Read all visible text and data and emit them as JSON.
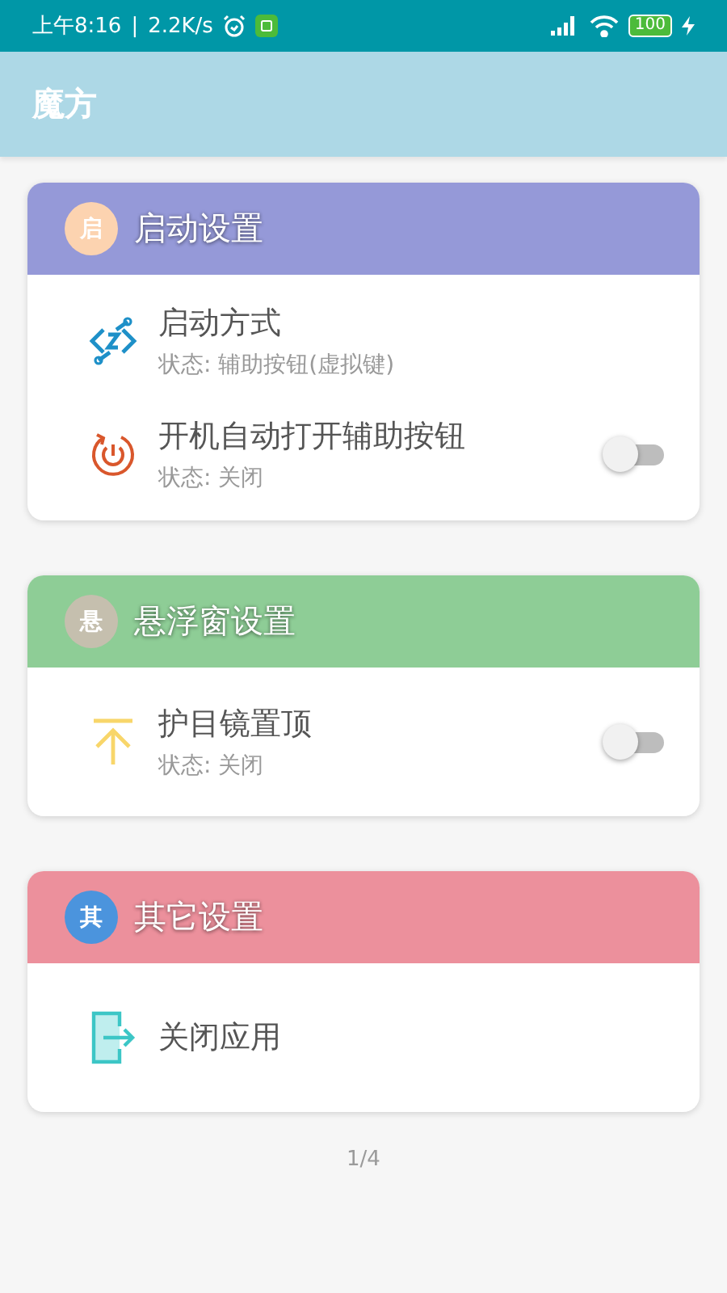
{
  "status_bar": {
    "time": "上午8:16",
    "separator": "|",
    "speed": "2.2K/s",
    "battery": "100"
  },
  "app_bar": {
    "title": "魔方"
  },
  "sections": [
    {
      "badge": {
        "text": "启",
        "color": "#fcd3b0"
      },
      "title": "启动设置",
      "color": "#9599d8",
      "items": [
        {
          "kind": "plain",
          "title": "启动方式",
          "status": "状态: 辅助按钮(虚拟键)"
        },
        {
          "kind": "toggle",
          "title": "开机自动打开辅助按钮",
          "status": "状态: 关闭",
          "on": false
        }
      ]
    },
    {
      "badge": {
        "text": "悬",
        "color": "#c5bfae"
      },
      "title": "悬浮窗设置",
      "color": "#8ecd96",
      "items": [
        {
          "kind": "toggle",
          "title": "护目镜置顶",
          "status": "状态: 关闭",
          "on": false
        }
      ]
    },
    {
      "badge": {
        "text": "其",
        "color": "#4b94dd"
      },
      "title": "其它设置",
      "color": "#ec909c",
      "items": [
        {
          "kind": "plain",
          "title": "关闭应用"
        }
      ]
    }
  ],
  "page_indicator": "1/4"
}
